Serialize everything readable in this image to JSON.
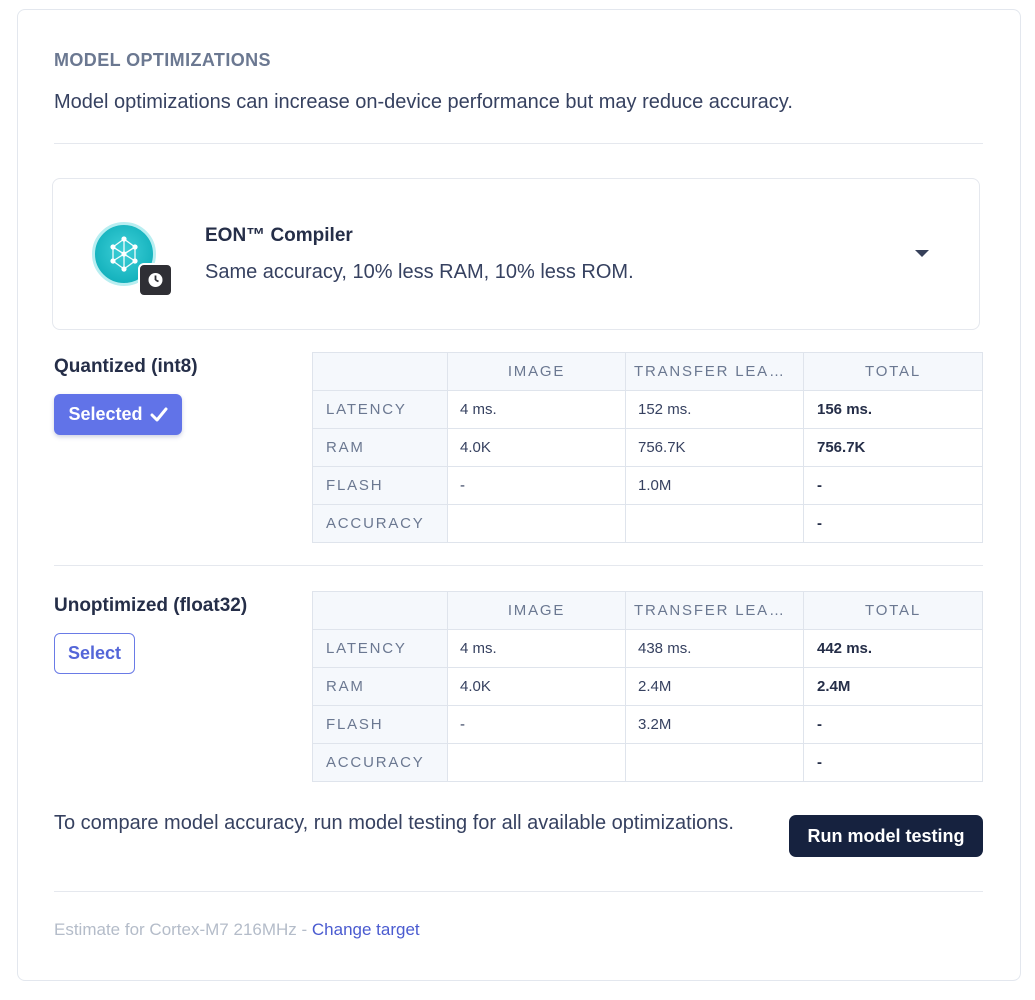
{
  "section": {
    "title": "MODEL OPTIMIZATIONS",
    "description": "Model optimizations can increase on-device performance but may reduce accuracy."
  },
  "eon": {
    "title": "EON™ Compiler",
    "subtitle": "Same accuracy, 10% less RAM, 10% less ROM.",
    "icon": "neural-network-icon",
    "badge_icon": "clock-icon",
    "accent": "#16b3be"
  },
  "columns": [
    "",
    "IMAGE",
    "TRANSFER LEAR…",
    "TOTAL"
  ],
  "variants": [
    {
      "title": "Quantized (int8)",
      "button_label": "Selected",
      "selected": true,
      "rows": [
        {
          "label": "LATENCY",
          "image": "4 ms.",
          "transfer": "152 ms.",
          "total": "156 ms."
        },
        {
          "label": "RAM",
          "image": "4.0K",
          "transfer": "756.7K",
          "total": "756.7K"
        },
        {
          "label": "FLASH",
          "image": "-",
          "transfer": "1.0M",
          "total": "-"
        },
        {
          "label": "ACCURACY",
          "image": "",
          "transfer": "",
          "total": "-"
        }
      ]
    },
    {
      "title": "Unoptimized (float32)",
      "button_label": "Select",
      "selected": false,
      "rows": [
        {
          "label": "LATENCY",
          "image": "4 ms.",
          "transfer": "438 ms.",
          "total": "442 ms."
        },
        {
          "label": "RAM",
          "image": "4.0K",
          "transfer": "2.4M",
          "total": "2.4M"
        },
        {
          "label": "FLASH",
          "image": "-",
          "transfer": "3.2M",
          "total": "-"
        },
        {
          "label": "ACCURACY",
          "image": "",
          "transfer": "",
          "total": "-"
        }
      ]
    }
  ],
  "compare": {
    "text": "To compare model accuracy, run model testing for all available optimizations.",
    "button_label": "Run model testing"
  },
  "footer": {
    "prefix": "Estimate for Cortex-M7 216MHz - ",
    "link": "Change target"
  },
  "colors": {
    "primary": "#6173e8",
    "dark_button": "#16223f",
    "link": "#4a5bd0"
  }
}
